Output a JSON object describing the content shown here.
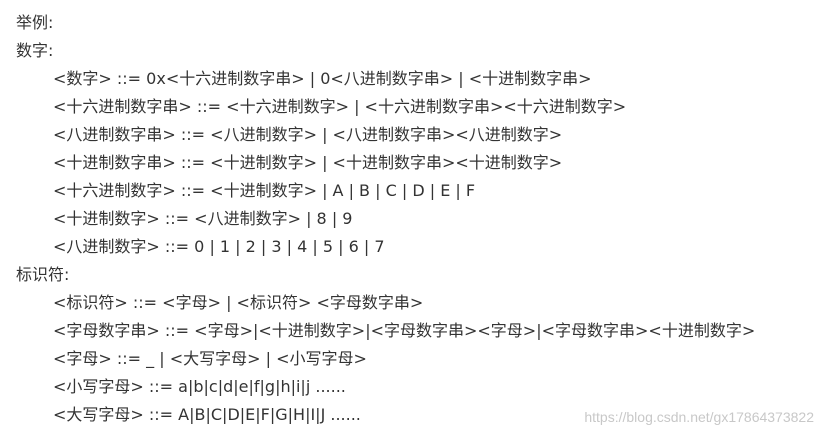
{
  "doc": {
    "intro": "举例:",
    "sections": [
      {
        "heading": "数字:",
        "rules": [
          "<数字> ::= 0x<十六进制数字串> | 0<八进制数字串> | <十进制数字串>",
          "<十六进制数字串> ::= <十六进制数字> | <十六进制数字串><十六进制数字>",
          "<八进制数字串> ::= <八进制数字> | <八进制数字串><八进制数字>",
          "<十进制数字串> ::= <十进制数字> | <十进制数字串><十进制数字>",
          "<十六进制数字> ::= <十进制数字> | A | B | C | D | E | F",
          "<十进制数字> ::= <八进制数字> | 8 | 9",
          "<八进制数字> ::= 0 | 1 | 2 | 3 | 4 | 5 | 6 | 7"
        ]
      },
      {
        "heading": "标识符:",
        "rules": [
          "<标识符> ::= <字母> | <标识符> <字母数字串>",
          "<字母数字串> ::= <字母>|<十进制数字>|<字母数字串><字母>|<字母数字串><十进制数字>",
          "<字母> ::= _ | <大写字母> | <小写字母>",
          "<小写字母> ::= a|b|c|d|e|f|g|h|i|j ......",
          "<大写字母> ::= A|B|C|D|E|F|G|H|I|J ......"
        ]
      }
    ]
  },
  "watermark": "https://blog.csdn.net/gx17864373822"
}
